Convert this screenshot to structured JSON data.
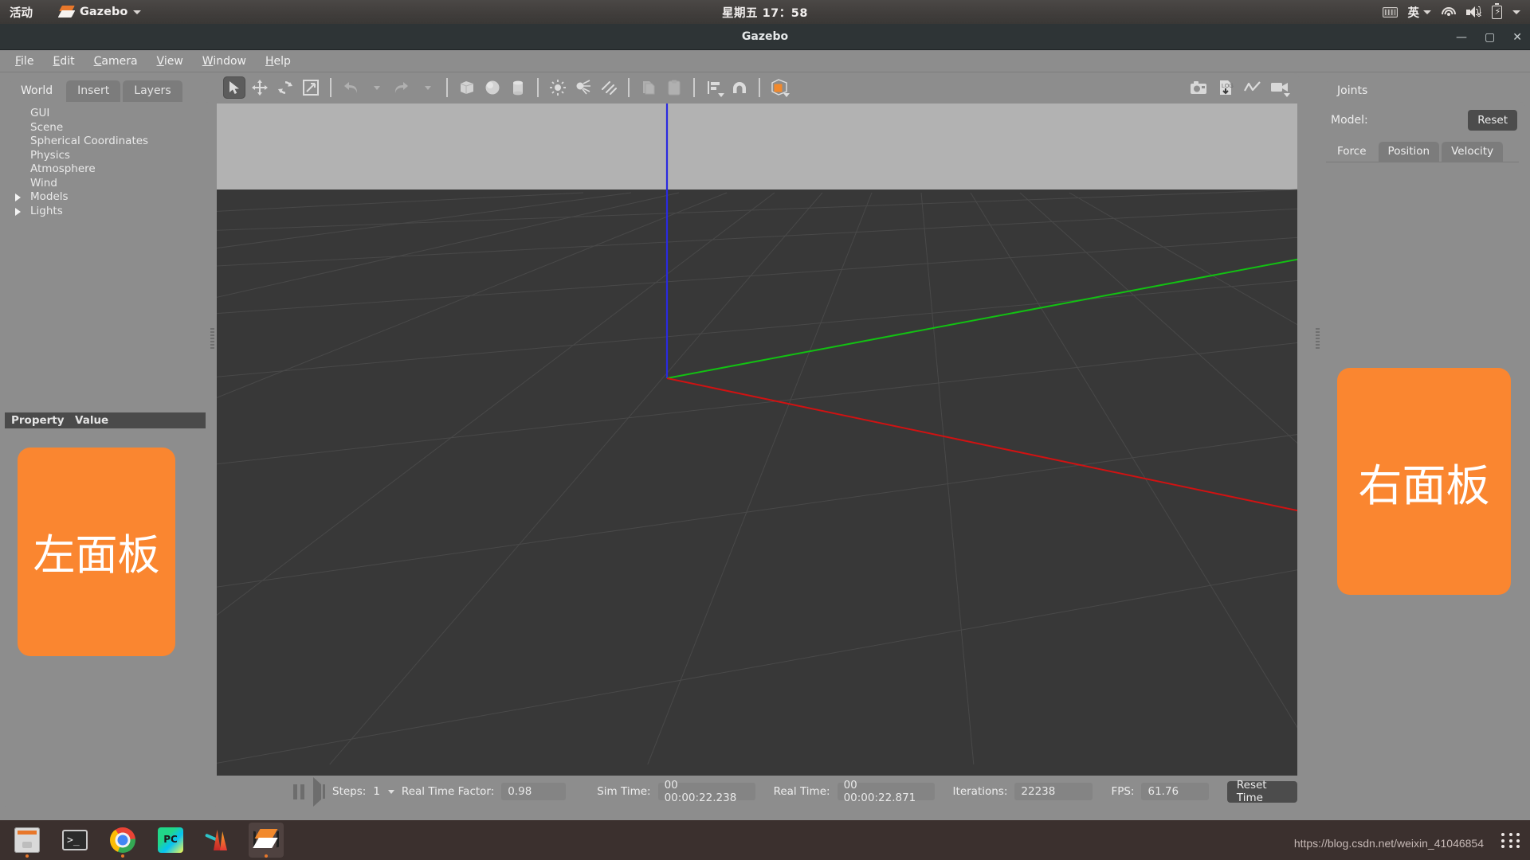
{
  "gnome": {
    "activities": "活动",
    "app_name": "Gazebo",
    "clock": "星期五 17：58",
    "status_icons": [
      "keyboard-icon",
      "input-method-英",
      "wifi-icon",
      "volume-muted-icon",
      "battery-charging-icon",
      "system-menu-caret"
    ],
    "input_method": "英"
  },
  "window": {
    "title": "Gazebo",
    "controls": {
      "minimize": "—",
      "maximize": "▢",
      "close": "✕"
    }
  },
  "menubar": [
    {
      "label": "File",
      "mnemonic": "F"
    },
    {
      "label": "Edit",
      "mnemonic": "E"
    },
    {
      "label": "Camera",
      "mnemonic": "C"
    },
    {
      "label": "View",
      "mnemonic": "V"
    },
    {
      "label": "Window",
      "mnemonic": "W"
    },
    {
      "label": "Help",
      "mnemonic": "H"
    }
  ],
  "left_panel": {
    "tabs": [
      {
        "label": "World",
        "active": true
      },
      {
        "label": "Insert",
        "active": false
      },
      {
        "label": "Layers",
        "active": false
      }
    ],
    "tree": [
      {
        "label": "GUI",
        "expandable": false
      },
      {
        "label": "Scene",
        "expandable": false
      },
      {
        "label": "Spherical Coordinates",
        "expandable": false
      },
      {
        "label": "Physics",
        "expandable": false
      },
      {
        "label": "Atmosphere",
        "expandable": false
      },
      {
        "label": "Wind",
        "expandable": false
      },
      {
        "label": "Models",
        "expandable": true
      },
      {
        "label": "Lights",
        "expandable": true
      }
    ],
    "property_header": {
      "property": "Property",
      "value": "Value"
    },
    "annotation": "左面板"
  },
  "toolbar": {
    "left_tools": [
      {
        "name": "select-mode",
        "icon": "cursor-arrow-icon",
        "active": true,
        "disabled": false
      },
      {
        "name": "translate-mode",
        "icon": "move-arrows-icon",
        "active": false,
        "disabled": false
      },
      {
        "name": "rotate-mode",
        "icon": "rotate-icon",
        "active": false,
        "disabled": false
      },
      {
        "name": "scale-mode",
        "icon": "scale-icon",
        "active": false,
        "disabled": false
      },
      {
        "name": "undo",
        "icon": "undo-arrow-icon",
        "active": false,
        "disabled": true
      },
      {
        "name": "undo-history",
        "icon": "chevron-down-icon",
        "active": false,
        "disabled": true
      },
      {
        "name": "redo",
        "icon": "redo-arrow-icon",
        "active": false,
        "disabled": true
      },
      {
        "name": "redo-history",
        "icon": "chevron-down-icon",
        "active": false,
        "disabled": true
      },
      {
        "name": "insert-box",
        "icon": "box-icon",
        "active": false,
        "disabled": false
      },
      {
        "name": "insert-sphere",
        "icon": "sphere-icon",
        "active": false,
        "disabled": false
      },
      {
        "name": "insert-cylinder",
        "icon": "cylinder-icon",
        "active": false,
        "disabled": false
      },
      {
        "name": "insert-point-light",
        "icon": "point-light-icon",
        "active": false,
        "disabled": false
      },
      {
        "name": "insert-spot-light",
        "icon": "spot-light-icon",
        "active": false,
        "disabled": false
      },
      {
        "name": "insert-directional-light",
        "icon": "directional-light-icon",
        "active": false,
        "disabled": false
      },
      {
        "name": "copy",
        "icon": "copy-icon",
        "active": false,
        "disabled": true
      },
      {
        "name": "paste",
        "icon": "paste-icon",
        "active": false,
        "disabled": true
      },
      {
        "name": "align",
        "icon": "align-icon",
        "active": false,
        "disabled": false
      },
      {
        "name": "snap",
        "icon": "magnet-snap-icon",
        "active": false,
        "disabled": false
      },
      {
        "name": "view-mode",
        "icon": "orange-cube-icon",
        "active": false,
        "disabled": false
      }
    ],
    "right_tools": [
      {
        "name": "screenshot",
        "icon": "camera-icon"
      },
      {
        "name": "log-record",
        "icon": "log-download-icon"
      },
      {
        "name": "plot-window",
        "icon": "plot-zigzag-icon"
      },
      {
        "name": "video-record",
        "icon": "video-camera-icon"
      }
    ]
  },
  "viewport": {
    "sky_color": "#b2b2b2",
    "ground_color": "#383838",
    "grid_color": "#4d4d4d",
    "axes": [
      {
        "name": "x-axis",
        "color": "#cc0000"
      },
      {
        "name": "y-axis",
        "color": "#00cc00"
      },
      {
        "name": "z-axis",
        "color": "#2222dd"
      }
    ]
  },
  "playbar": {
    "pause_icon": "pause-icon",
    "step_icon": "step-forward-icon",
    "steps_label": "Steps:",
    "steps_value": "1",
    "rtf_label": "Real Time Factor:",
    "rtf_value": "0.98",
    "sim_time_label": "Sim Time:",
    "sim_time_value": "00 00:00:22.238",
    "real_time_label": "Real Time:",
    "real_time_value": "00 00:00:22.871",
    "iterations_label": "Iterations:",
    "iterations_value": "22238",
    "fps_label": "FPS:",
    "fps_value": "61.76",
    "reset_button": "Reset Time"
  },
  "right_panel": {
    "tabs": [
      {
        "label": "Joints",
        "active": true
      }
    ],
    "model_label": "Model:",
    "reset_button": "Reset",
    "subtabs": [
      {
        "label": "Force",
        "active": true
      },
      {
        "label": "Position",
        "active": false
      },
      {
        "label": "Velocity",
        "active": false
      }
    ],
    "annotation": "右面板"
  },
  "taskbar": {
    "apps": [
      {
        "name": "files-icon",
        "label": "Files",
        "active": false,
        "running": true
      },
      {
        "name": "terminal-icon",
        "label": "Terminal",
        "active": false,
        "running": false
      },
      {
        "name": "chrome-icon",
        "label": "Google Chrome",
        "active": false,
        "running": true
      },
      {
        "name": "pycharm-icon",
        "label": "PyCharm",
        "active": false,
        "running": false
      },
      {
        "name": "matlab-icon",
        "label": "MATLAB",
        "active": false,
        "running": false
      },
      {
        "name": "gazebo-icon",
        "label": "Gazebo",
        "active": true,
        "running": true
      }
    ],
    "watermark": "https://blog.csdn.net/weixin_41046854",
    "show_apps_icon": "grid-dots-icon"
  },
  "colors": {
    "accent_orange": "#fa8630",
    "panel_gray": "#8d8d8d",
    "titlebar": "#2e3436",
    "taskbar": "#3b302e"
  }
}
